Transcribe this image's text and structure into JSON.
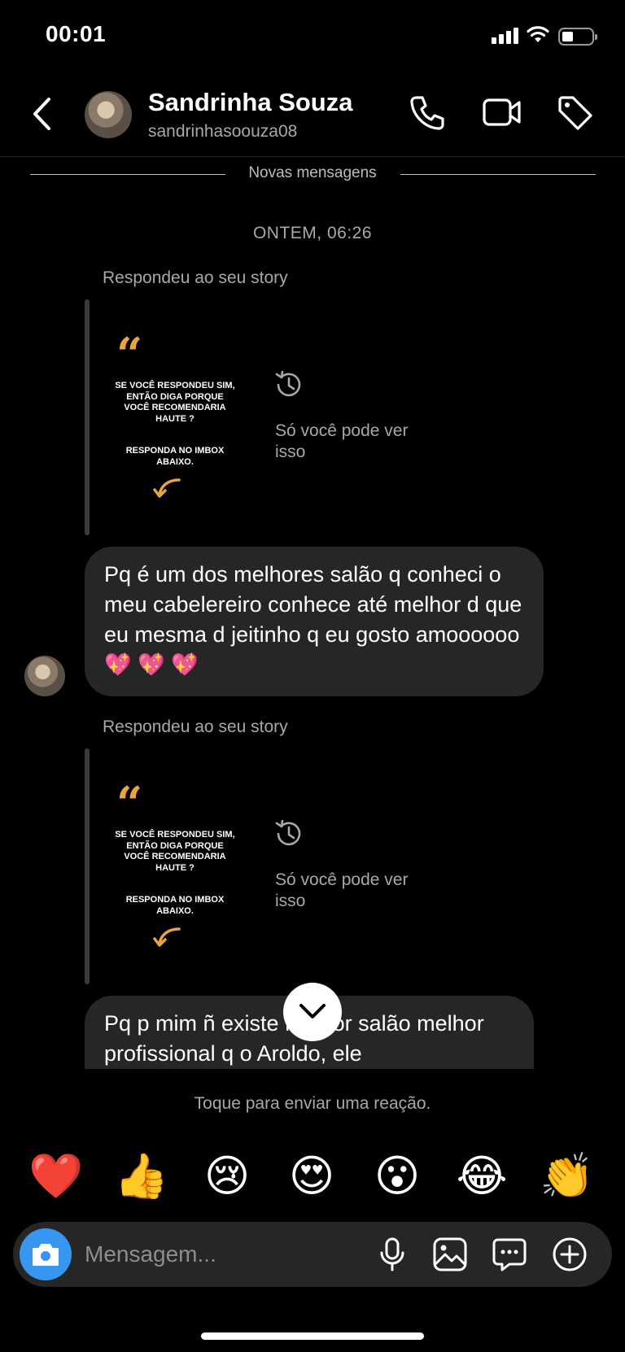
{
  "status_bar": {
    "time": "00:01"
  },
  "header": {
    "name": "Sandrinha Souza",
    "username": "sandrinhasoouza08",
    "icons": [
      "back-chevron-icon",
      "phone-icon",
      "video-camera-icon",
      "tag-icon"
    ]
  },
  "thread": {
    "new_messages_label": "Novas mensagens",
    "timestamp": "ONTEM, 06:26",
    "items": [
      {
        "type": "story_reply",
        "label": "Respondeu ao seu story",
        "story_text": "SE VOCÊ RESPONDEU SIM, ENTÃO DIGA PORQUE VOCÊ RECOMENDARIA HAUTE ?",
        "story_cta": "RESPONDA NO IMBOX ABAIXO.",
        "private_notice": "Só você pode ver isso"
      },
      {
        "type": "message",
        "text": "Pq é  um dos melhores salão q conheci o meu cabelereiro conhece até  melhor d que eu mesma d jeitinho q eu gosto amoooooo💖 💖 💖"
      },
      {
        "type": "story_reply",
        "label": "Respondeu ao seu story",
        "story_text": "SE VOCÊ RESPONDEU SIM, ENTÃO DIGA PORQUE VOCÊ RECOMENDARIA HAUTE ?",
        "story_cta": "RESPONDA NO IMBOX ABAIXO.",
        "private_notice": "Só você pode ver isso"
      },
      {
        "type": "message",
        "text": "Pq p mim ñ existe melhor salão melhor profissional q o Aroldo, ele"
      }
    ]
  },
  "reactions": {
    "hint": "Toque para enviar uma reação.",
    "emojis": [
      "❤️",
      "👍",
      "😢",
      "😍",
      "😮",
      "😂",
      "👏"
    ]
  },
  "composer": {
    "placeholder": "Mensagem...",
    "icons": [
      "camera-icon",
      "microphone-icon",
      "gallery-icon",
      "sticker-chat-icon",
      "plus-icon"
    ]
  }
}
